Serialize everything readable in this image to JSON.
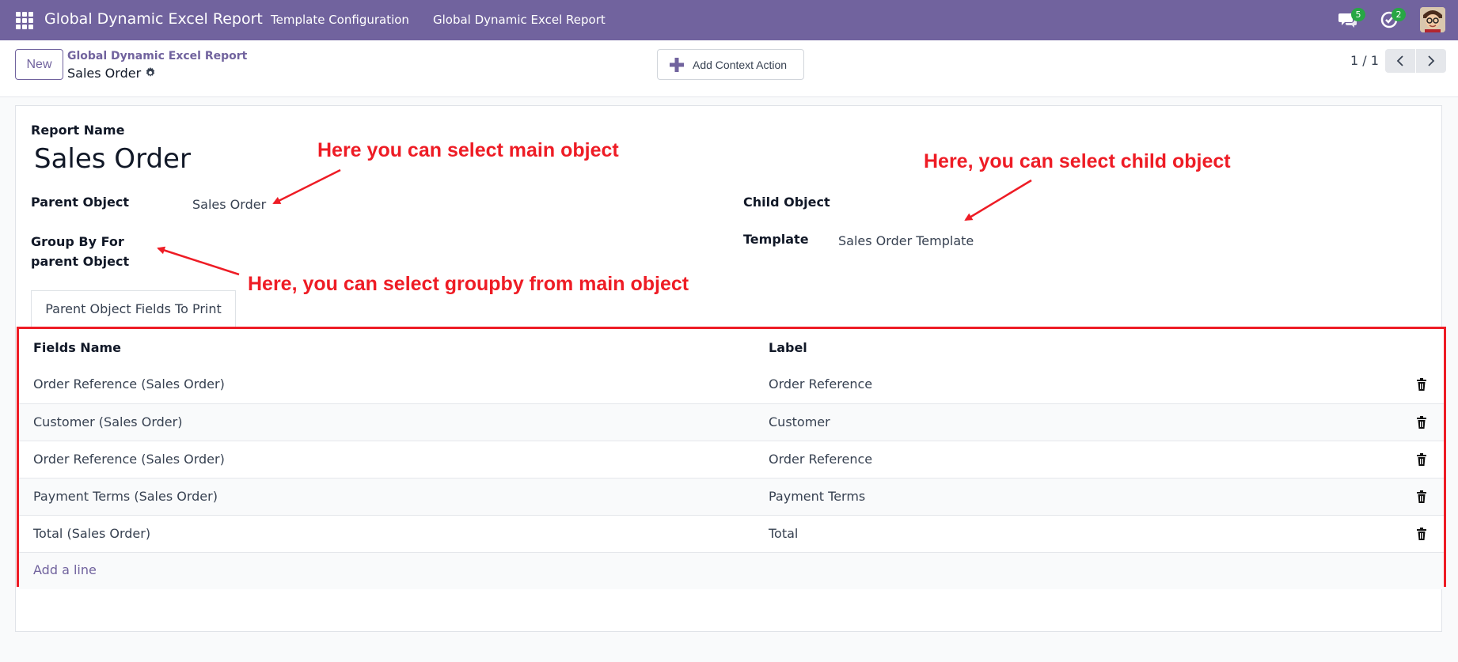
{
  "navbar": {
    "brand": "Global Dynamic Excel Report",
    "menu": [
      "Template Configuration",
      "Global Dynamic Excel Report"
    ],
    "chat_badge": "5",
    "activity_badge": "2",
    "color": "#71639e"
  },
  "control": {
    "new_label": "New",
    "breadcrumb_parent": "Global Dynamic Excel Report",
    "breadcrumb_current": "Sales Order",
    "context_action_label": "Add Context Action",
    "pager": "1 / 1"
  },
  "form": {
    "report_name_label": "Report Name",
    "report_name": "Sales Order",
    "parent_object_label": "Parent Object",
    "parent_object_value": "Sales Order",
    "group_by_label": "Group By For parent Object",
    "child_object_label": "Child Object",
    "template_label": "Template",
    "template_value": "Sales Order Template"
  },
  "tab": {
    "label": "Parent Object Fields To Print"
  },
  "table": {
    "headers": [
      "Fields Name",
      "Label"
    ],
    "rows": [
      {
        "field": "Order Reference (Sales Order)",
        "label": "Order Reference"
      },
      {
        "field": "Customer (Sales Order)",
        "label": "Customer"
      },
      {
        "field": "Order Reference (Sales Order)",
        "label": "Order Reference"
      },
      {
        "field": "Payment Terms (Sales Order)",
        "label": "Payment Terms"
      },
      {
        "field": "Total (Sales Order)",
        "label": "Total"
      }
    ],
    "add_line": "Add a line"
  },
  "annotations": {
    "main_object": "Here you can select main object",
    "child_object": "Here, you can select child object",
    "groupby": "Here, you can select groupby from main object",
    "color": "#ee1c25"
  }
}
